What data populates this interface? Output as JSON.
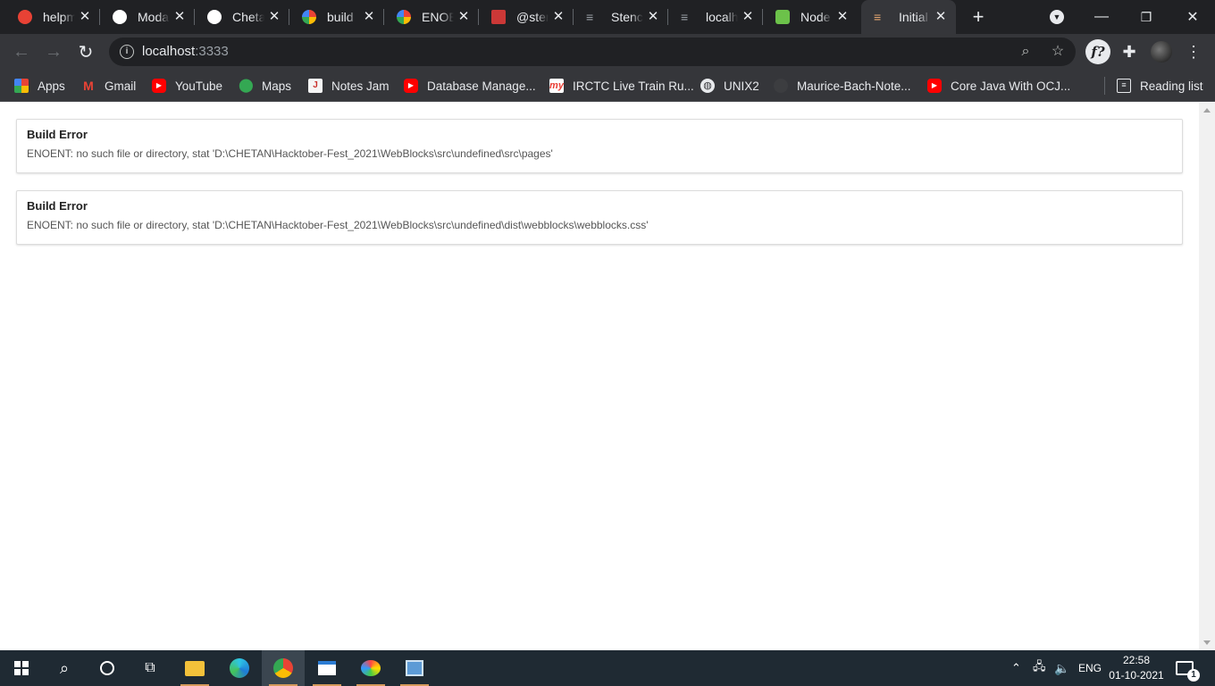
{
  "browser": {
    "tabs": [
      {
        "title": "helpm",
        "icon": "chrome-help-icon",
        "color": "#e84235"
      },
      {
        "title": "Moda",
        "icon": "github-icon",
        "color": "#ffffff"
      },
      {
        "title": "Cheta",
        "icon": "github-icon",
        "color": "#ffffff"
      },
      {
        "title": "build",
        "icon": "google-icon",
        "color": "#4285f4"
      },
      {
        "title": "ENOE",
        "icon": "google-icon",
        "color": "#4285f4"
      },
      {
        "title": "@ster",
        "icon": "npm-icon",
        "color": "#cb3837"
      },
      {
        "title": "Stenci",
        "icon": "stencil-icon",
        "color": "#9aa0a6"
      },
      {
        "title": "localh",
        "icon": "stencil-icon",
        "color": "#9aa0a6"
      },
      {
        "title": "Node",
        "icon": "nodejs-icon",
        "color": "#6cc24a"
      },
      {
        "title": "Initial",
        "icon": "stencil-icon",
        "color": "#e8a871"
      }
    ],
    "active_tab_index": 9,
    "url_host": "localhost",
    "url_port": ":3333",
    "bookmarks": [
      {
        "label": "Apps",
        "icon": "apps-grid-icon"
      },
      {
        "label": "Gmail",
        "icon": "gmail-icon"
      },
      {
        "label": "YouTube",
        "icon": "youtube-icon"
      },
      {
        "label": "Maps",
        "icon": "maps-pin-icon"
      },
      {
        "label": "Notes Jam",
        "icon": "notes-jam-icon"
      },
      {
        "label": "Database Manage...",
        "icon": "youtube-icon"
      },
      {
        "label": "IRCTC Live Train Ru...",
        "icon": "makemytrip-icon"
      },
      {
        "label": "UNIX2",
        "icon": "globe-icon"
      },
      {
        "label": "Maurice-Bach-Note...",
        "icon": "github-icon"
      },
      {
        "label": "Core Java With OCJ...",
        "icon": "youtube-icon"
      }
    ],
    "reading_list": "Reading list"
  },
  "page": {
    "errors": [
      {
        "title": "Build Error",
        "message": "ENOENT: no such file or directory, stat 'D:\\CHETAN\\Hacktober-Fest_2021\\WebBlocks\\src\\undefined\\src\\pages'"
      },
      {
        "title": "Build Error",
        "message": "ENOENT: no such file or directory, stat 'D:\\CHETAN\\Hacktober-Fest_2021\\WebBlocks\\src\\undefined\\dist\\webblocks\\webblocks.css'"
      }
    ]
  },
  "taskbar": {
    "language": "ENG",
    "time": "22:58",
    "date": "01-10-2021",
    "notification_count": "1"
  },
  "colors": {
    "tabstrip_bg": "#202124",
    "toolbar_bg": "#35363a",
    "taskbar_bg": "#1f2a33",
    "running_indicator": "#d59a5b"
  }
}
